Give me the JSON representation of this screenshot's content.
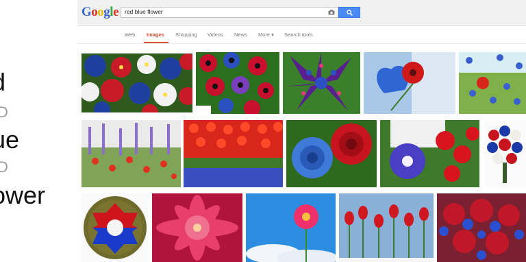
{
  "slide_fragments": [
    {
      "text": "d",
      "gray": false
    },
    {
      "text": "D",
      "gray": true
    },
    {
      "text": "ue",
      "gray": false
    },
    {
      "text": "D",
      "gray": true
    },
    {
      "text": "ower",
      "gray": false
    }
  ],
  "logo": {
    "letters": [
      {
        "ch": "G",
        "color": "#3366cc"
      },
      {
        "ch": "o",
        "color": "#dd3322"
      },
      {
        "ch": "o",
        "color": "#eebb00"
      },
      {
        "ch": "g",
        "color": "#3366cc"
      },
      {
        "ch": "l",
        "color": "#33aa44"
      },
      {
        "ch": "e",
        "color": "#dd3322"
      }
    ]
  },
  "search": {
    "query": "red blue flower",
    "camera_icon": "camera-icon",
    "button_icon": "search-icon"
  },
  "nav": {
    "items": [
      {
        "label": "Web",
        "active": false
      },
      {
        "label": "Images",
        "active": true
      },
      {
        "label": "Shopping",
        "active": false
      },
      {
        "label": "Videos",
        "active": false
      },
      {
        "label": "News",
        "active": false
      },
      {
        "label": "More ▾",
        "active": false
      },
      {
        "label": "Search tools",
        "active": false
      }
    ]
  },
  "results": {
    "rows": [
      [
        {
          "subject": "petunias-red-white-blue"
        },
        {
          "subject": "anemones-red-blue"
        },
        {
          "subject": "bromeliad-purple"
        },
        {
          "subject": "red-gerbera-blue-heart"
        },
        {
          "subject": "field-poppies-cornflowers"
        }
      ],
      [
        {
          "subject": "poppy-lupine-meadow"
        },
        {
          "subject": "tulip-field-red-blue"
        },
        {
          "subject": "blue-and-red-roses"
        },
        {
          "subject": "morning-glory-red-flowers"
        },
        {
          "subject": "bridal-bouquet-red-white-blue"
        }
      ],
      [
        {
          "subject": "infantry-division-patch"
        },
        {
          "subject": "pink-dahlia"
        },
        {
          "subject": "pink-gerbera-blue-sky"
        },
        {
          "subject": "red-tulips-sky"
        },
        {
          "subject": "red-roses-blue-cornflower-bouquet"
        }
      ]
    ]
  },
  "colors": {
    "accent_red": "#dd4b39",
    "search_blue": "#4a8af4",
    "bar_bg": "#f1f1f1"
  }
}
